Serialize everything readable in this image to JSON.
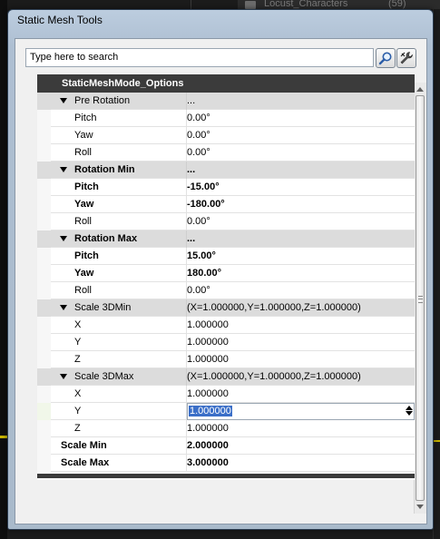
{
  "background": {
    "folder_label": "Locust_Characters",
    "folder_count": "(59)"
  },
  "window": {
    "title": "Static Mesh Tools"
  },
  "search": {
    "placeholder": "Type here to search"
  },
  "icons": {
    "search_button": "magnifier-icon",
    "options_button": "wrench-icon"
  },
  "grid": {
    "header": "StaticMeshMode_Options",
    "rows": [
      {
        "kind": "category",
        "name": "Pre Rotation",
        "value": "...",
        "bold": false
      },
      {
        "kind": "child",
        "name": "Pitch",
        "value": "0.00°",
        "bold": false
      },
      {
        "kind": "child",
        "name": "Yaw",
        "value": "0.00°",
        "bold": false
      },
      {
        "kind": "child",
        "name": "Roll",
        "value": "0.00°",
        "bold": false
      },
      {
        "kind": "category",
        "name": "Rotation Min",
        "value": "...",
        "bold": true
      },
      {
        "kind": "child",
        "name": "Pitch",
        "value": "-15.00°",
        "bold": true
      },
      {
        "kind": "child",
        "name": "Yaw",
        "value": "-180.00°",
        "bold": true
      },
      {
        "kind": "child",
        "name": "Roll",
        "value": "0.00°",
        "bold": false
      },
      {
        "kind": "category",
        "name": "Rotation Max",
        "value": "...",
        "bold": true
      },
      {
        "kind": "child",
        "name": "Pitch",
        "value": "15.00°",
        "bold": true
      },
      {
        "kind": "child",
        "name": "Yaw",
        "value": "180.00°",
        "bold": true
      },
      {
        "kind": "child",
        "name": "Roll",
        "value": "0.00°",
        "bold": false
      },
      {
        "kind": "category",
        "name": "Scale 3DMin",
        "value": "(X=1.000000,Y=1.000000,Z=1.000000)",
        "bold": false
      },
      {
        "kind": "child",
        "name": "X",
        "value": "1.000000",
        "bold": false
      },
      {
        "kind": "child",
        "name": "Y",
        "value": "1.000000",
        "bold": false
      },
      {
        "kind": "child",
        "name": "Z",
        "value": "1.000000",
        "bold": false
      },
      {
        "kind": "category",
        "name": "Scale 3DMax",
        "value": "(X=1.000000,Y=1.000000,Z=1.000000)",
        "bold": false
      },
      {
        "kind": "child",
        "name": "X",
        "value": "1.000000",
        "bold": false
      },
      {
        "kind": "selected",
        "name": "Y",
        "value": "1.000000",
        "bold": false
      },
      {
        "kind": "child",
        "name": "Z",
        "value": "1.000000",
        "bold": false
      },
      {
        "kind": "top",
        "name": "Scale Min",
        "value": "2.000000",
        "bold": true
      },
      {
        "kind": "top",
        "name": "Scale Max",
        "value": "3.000000",
        "bold": true
      }
    ]
  },
  "colors": {
    "header_bg": "#3b3b3b",
    "category_bg": "#dcdcdc",
    "selection": "#3b6fc8"
  }
}
